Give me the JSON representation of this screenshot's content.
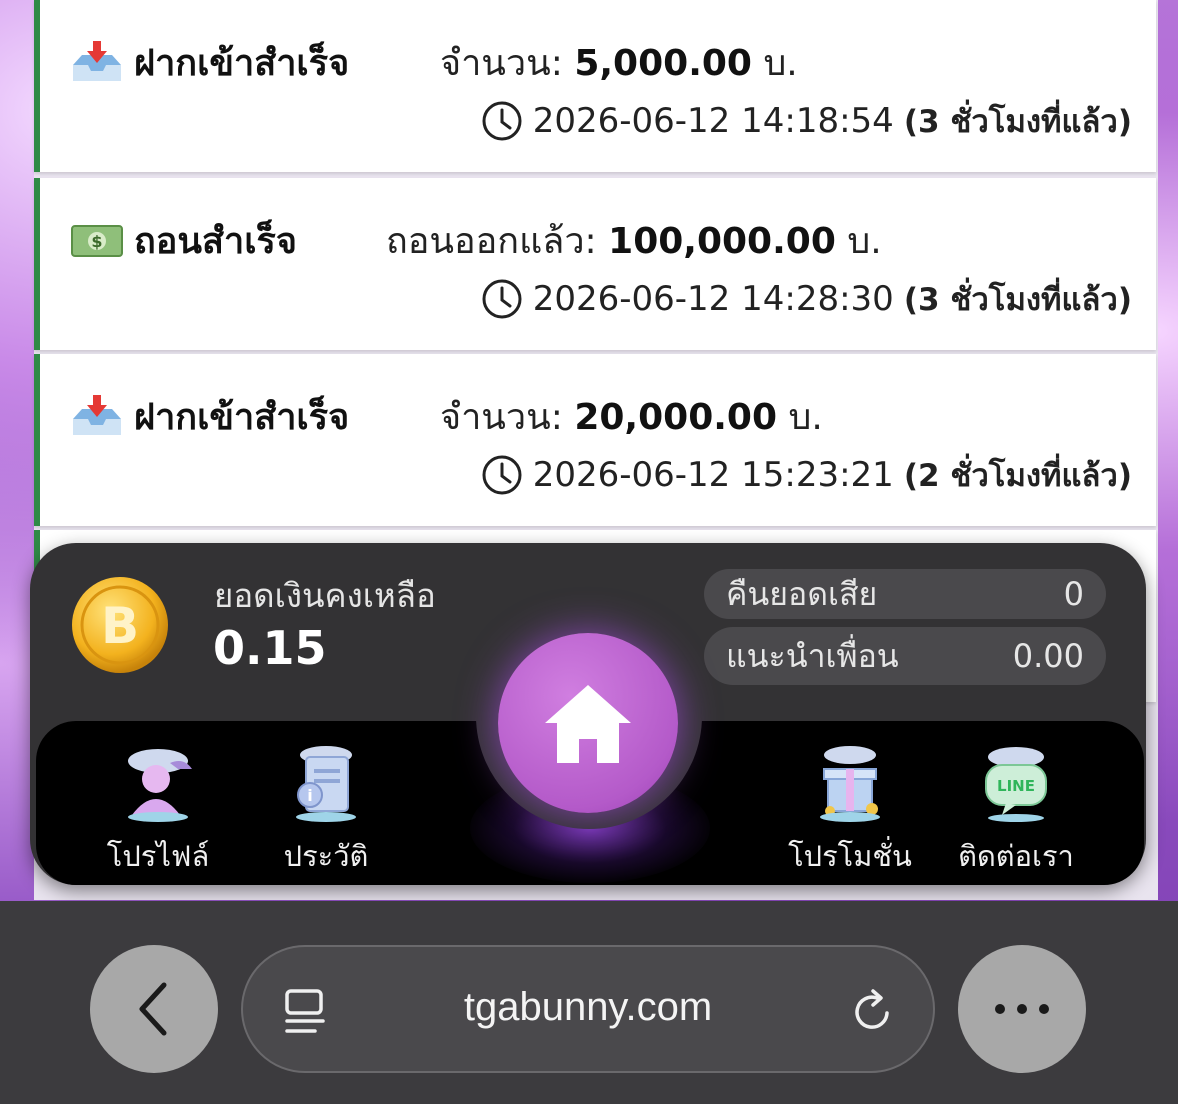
{
  "transactions": [
    {
      "title": "ฝากเข้าสำเร็จ",
      "icon": "inbox-tray-icon",
      "amount_label": "จำนวน:",
      "amount": "5,000.00",
      "currency": "บ.",
      "datetime": "2026-06-12 14:18:54",
      "ago": "(3 ชั่วโมงที่แล้ว)"
    },
    {
      "title": "ถอนสำเร็จ",
      "icon": "banknote-icon",
      "amount_label": "ถอนออกแล้ว:",
      "amount": "100,000.00",
      "currency": "บ.",
      "datetime": "2026-06-12 14:28:30",
      "ago": "(3 ชั่วโมงที่แล้ว)"
    },
    {
      "title": "ฝากเข้าสำเร็จ",
      "icon": "inbox-tray-icon",
      "amount_label": "จำนวน:",
      "amount": "20,000.00",
      "currency": "บ.",
      "datetime": "2026-06-12 15:23:21",
      "ago": "(2 ชั่วโมงที่แล้ว)"
    }
  ],
  "wallet": {
    "balance_label": "ยอดเงินคงเหลือ",
    "balance_value": "0.15",
    "cashback_label": "คืนยอดเสีย",
    "cashback_value": "0",
    "referral_label": "แนะนำเพื่อน",
    "referral_value": "0.00"
  },
  "nav": {
    "profile": "โปรไฟล์",
    "history": "ประวัติ",
    "promotion": "โปรโมชั่น",
    "contact": "ติดต่อเรา"
  },
  "browser": {
    "url": "tgabunny.com"
  },
  "colors": {
    "success_border": "#2f8a46",
    "home_button": "#b45ac9",
    "dock_bg": "#333234"
  }
}
